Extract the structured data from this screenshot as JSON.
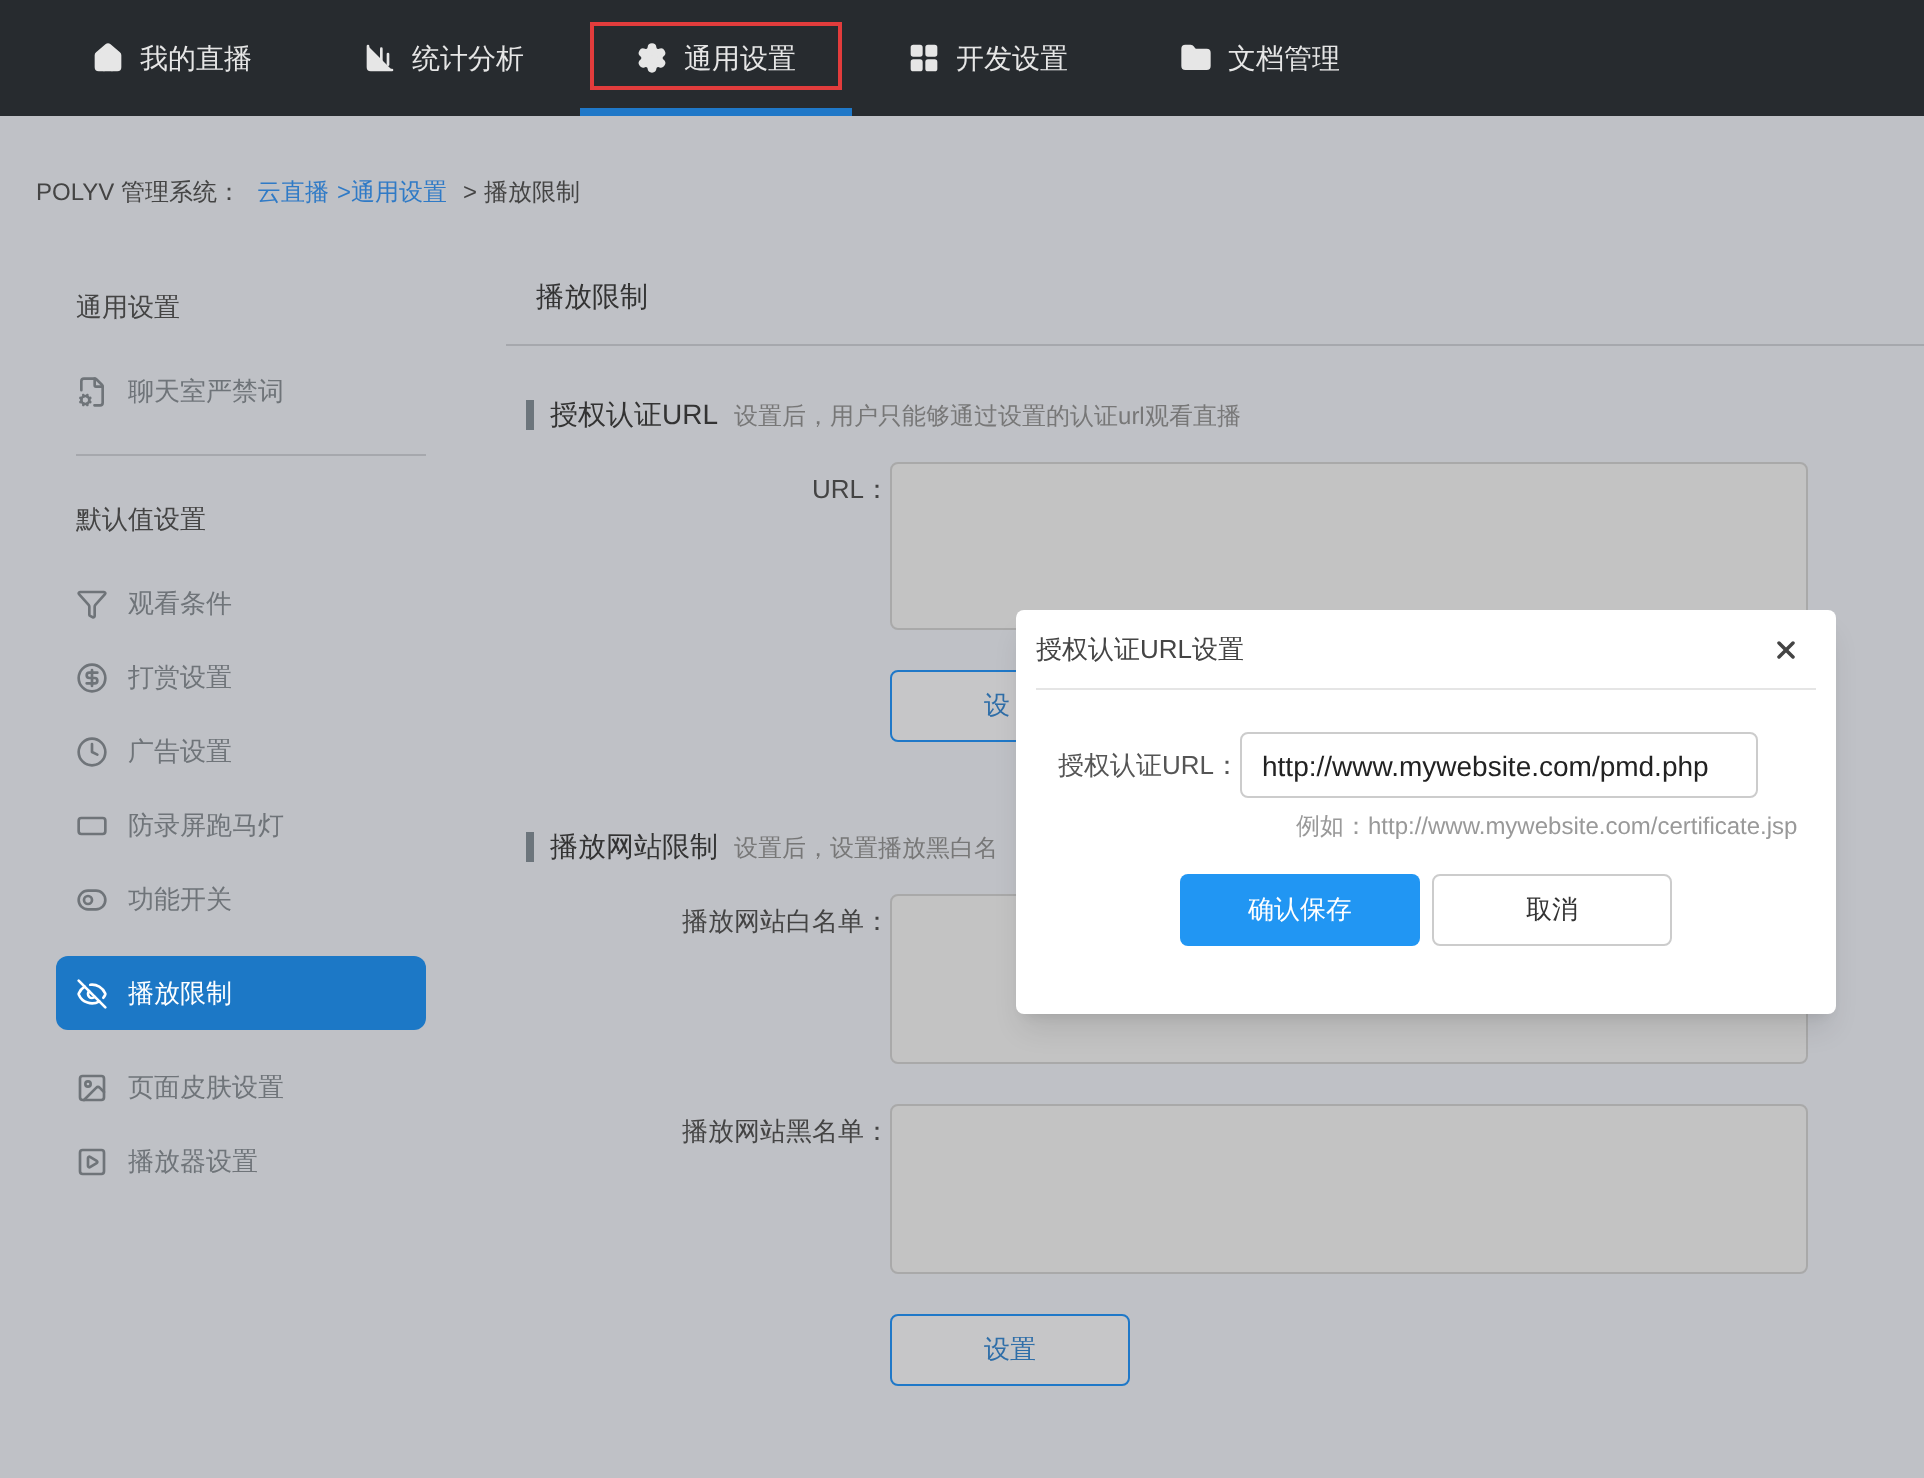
{
  "nav": {
    "tabs": [
      {
        "label": "我的直播",
        "selected": false,
        "highlighted": false
      },
      {
        "label": "统计分析",
        "selected": false,
        "highlighted": false
      },
      {
        "label": "通用设置",
        "selected": true,
        "highlighted": true
      },
      {
        "label": "开发设置",
        "selected": false,
        "highlighted": false
      },
      {
        "label": "文档管理",
        "selected": false,
        "highlighted": false
      }
    ]
  },
  "breadcrumb": {
    "prefix": "POLYV 管理系统：",
    "links": [
      "云直播",
      ">通用设置"
    ],
    "current": "> 播放限制"
  },
  "sidebar": {
    "groups": [
      {
        "title": "通用设置",
        "items": [
          {
            "label": "聊天室严禁词",
            "selected": false
          }
        ]
      },
      {
        "title": "默认值设置",
        "items": [
          {
            "label": "观看条件",
            "selected": false
          },
          {
            "label": "打赏设置",
            "selected": false
          },
          {
            "label": "广告设置",
            "selected": false
          },
          {
            "label": "防录屏跑马灯",
            "selected": false
          },
          {
            "label": "功能开关",
            "selected": false
          },
          {
            "label": "播放限制",
            "selected": true
          },
          {
            "label": "页面皮肤设置",
            "selected": false
          },
          {
            "label": "播放器设置",
            "selected": false
          }
        ]
      }
    ]
  },
  "main": {
    "title": "播放限制",
    "sections": [
      {
        "title": "授权认证URL",
        "hint": "设置后，用户只能够通过设置的认证url观看直播",
        "fields": [
          {
            "label": "URL："
          }
        ],
        "button": "设"
      },
      {
        "title": "播放网站限制",
        "hint": "设置后，设置播放黑白名",
        "fields": [
          {
            "label": "播放网站白名单："
          },
          {
            "label": "播放网站黑名单："
          }
        ],
        "button": "设置"
      }
    ]
  },
  "dialog": {
    "title": "授权认证URL设置",
    "field": {
      "label": "授权认证URL：",
      "value": "http://www.mywebsite.com/pmd.php"
    },
    "example": "例如：http://www.mywebsite.com/certificate.jsp",
    "buttons": [
      {
        "label": "确认保存",
        "kind": "primary"
      },
      {
        "label": "取消",
        "kind": "secondary"
      }
    ]
  }
}
